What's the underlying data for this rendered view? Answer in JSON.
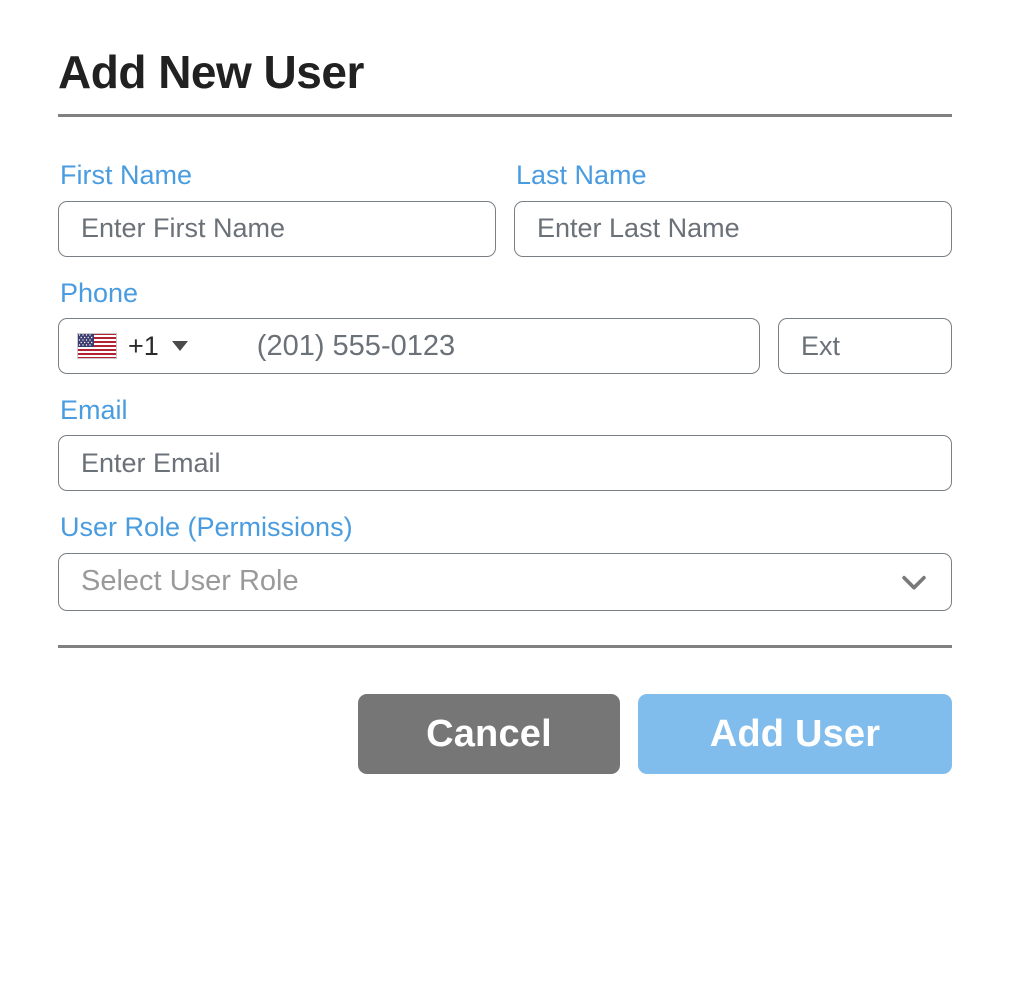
{
  "dialog": {
    "title": "Add New User"
  },
  "form": {
    "first_name": {
      "label": "First Name",
      "placeholder": "Enter First Name",
      "value": ""
    },
    "last_name": {
      "label": "Last Name",
      "placeholder": "Enter Last Name",
      "value": ""
    },
    "phone": {
      "label": "Phone",
      "country_code": "+1",
      "country_flag": "us-flag-icon",
      "placeholder": "(201) 555-0123",
      "value": "",
      "ext_placeholder": "Ext",
      "ext_value": ""
    },
    "email": {
      "label": "Email",
      "placeholder": "Enter Email",
      "value": ""
    },
    "user_role": {
      "label": "User Role (Permissions)",
      "placeholder": "Select User Role",
      "value": ""
    }
  },
  "footer": {
    "cancel_label": "Cancel",
    "submit_label": "Add User"
  },
  "colors": {
    "label_blue": "#4a9ce0",
    "title_text": "#212121",
    "rule_gray": "#808080",
    "border_gray": "#7a7f85",
    "placeholder_gray": "#6b7178",
    "select_placeholder_gray": "#9a9a9a",
    "cancel_gray": "#767676",
    "submit_blue": "#81bdec"
  }
}
